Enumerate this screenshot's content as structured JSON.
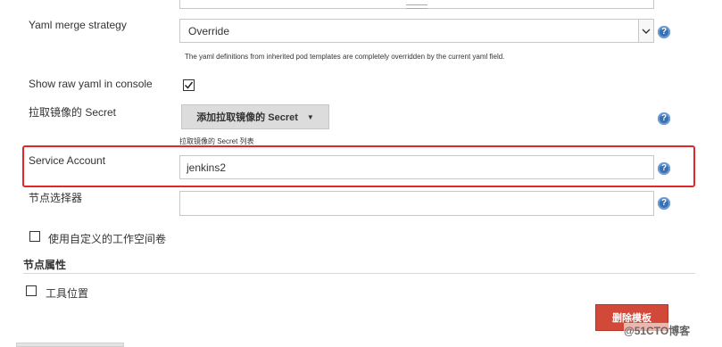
{
  "yaml_merge": {
    "label": "Yaml merge strategy",
    "value": "Override",
    "description": "The yaml definitions from inherited pod templates are completely overridden by the current yaml field."
  },
  "raw_yaml": {
    "label": "Show raw yaml in console",
    "checked": true
  },
  "image_pull_secret": {
    "label": "拉取镜像的 Secret",
    "button_label": "添加拉取镜像的 Secret",
    "hint": "拉取镜像的 Secret 列表"
  },
  "service_account": {
    "label": "Service Account",
    "value": "jenkins2"
  },
  "node_selector": {
    "label": "节点选择器",
    "value": ""
  },
  "custom_workspace": {
    "label": "使用自定义的工作空间卷"
  },
  "node_properties": {
    "heading": "节点属性",
    "tool_locations_label": "工具位置"
  },
  "delete_template_label": "删除模板",
  "watermark": "@51CTO博客",
  "colors": {
    "highlight": "#e0282b",
    "delete_button": "#d24939",
    "help_icon": "#3a6fb0"
  }
}
